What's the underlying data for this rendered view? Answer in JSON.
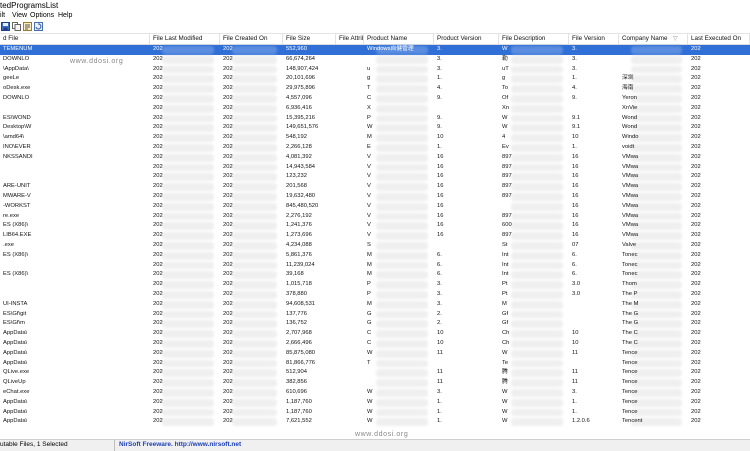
{
  "window": {
    "title": "tedProgramsList"
  },
  "menu": [
    "ilt",
    "View",
    "Options",
    "Help"
  ],
  "toolbar": [
    {
      "icon": "save-icon"
    },
    {
      "icon": "copy-icon"
    },
    {
      "icon": "properties-icon"
    },
    {
      "icon": "refresh-icon"
    }
  ],
  "columns": [
    "d File",
    "File Last Modified",
    "File Created On",
    "File Size",
    "File Attribu...",
    "Product Name",
    "Product Version",
    "File Description",
    "File Version",
    "Company Name",
    "Last Executed On"
  ],
  "rows": [
    {
      "file": "TEMENUM",
      "modified": "202",
      "created": "202",
      "size": "552,960",
      "attr": "",
      "product": "Windows自健管理",
      "pver": "3.",
      "desc": "W",
      "fver": "3.",
      "company": "",
      "last": "202",
      "selected": true
    },
    {
      "file": "DOWNLO",
      "modified": "202",
      "created": "202",
      "size": "66,674,264",
      "attr": "",
      "product": "",
      "pver": "3.",
      "desc": "勒",
      "fver": "3.",
      "company": "",
      "last": "202"
    },
    {
      "file": "\\AppData\\",
      "modified": "202",
      "created": "202",
      "size": "148,907,424",
      "attr": "",
      "product": "u",
      "pver": "3.",
      "desc": "uT",
      "fver": "3.",
      "company": "",
      "last": "202"
    },
    {
      "file": "geeLe",
      "modified": "202",
      "created": "202",
      "size": "20,101,696",
      "attr": "",
      "product": "g",
      "pver": "1.",
      "desc": "g",
      "fver": "1.",
      "company": "深圳",
      "last": "202"
    },
    {
      "file": "oDesk.exe",
      "modified": "202",
      "created": "202",
      "size": "29,975,896",
      "attr": "",
      "product": "T",
      "pver": "4.",
      "desc": "To",
      "fver": "4.",
      "company": "海南",
      "last": "202"
    },
    {
      "file": "DOWNLO",
      "modified": "202",
      "created": "202",
      "size": "4,557,096",
      "attr": "",
      "product": "C",
      "pver": "9.",
      "desc": "Of",
      "fver": "9.",
      "company": "Yeron",
      "last": "202"
    },
    {
      "file": "",
      "modified": "202",
      "created": "202",
      "size": "6,936,416",
      "attr": "",
      "product": "X",
      "pver": "",
      "desc": "Xn",
      "fver": "",
      "company": "XnVie",
      "last": "202"
    },
    {
      "file": "ES\\WOND",
      "modified": "202",
      "created": "202",
      "size": "15,395,216",
      "attr": "",
      "product": "P",
      "pver": "9.",
      "desc": "W",
      "fver": "9.1",
      "company": "Wond",
      "last": "202"
    },
    {
      "file": "Desktop\\W",
      "modified": "202",
      "created": "202",
      "size": "149,651,576",
      "attr": "",
      "product": "W",
      "pver": "9.",
      "desc": "W",
      "fver": "9.1",
      "company": "Wond",
      "last": "202"
    },
    {
      "file": "\\amd64\\",
      "modified": "202",
      "created": "202",
      "size": "548,192",
      "attr": "",
      "product": "M",
      "pver": "10",
      "desc": "4",
      "fver": "10",
      "company": "Windo",
      "last": "202"
    },
    {
      "file": "INO\\EVER",
      "modified": "202",
      "created": "202",
      "size": "2,266,128",
      "attr": "",
      "product": "E",
      "pver": "1.",
      "desc": "Ev",
      "fver": "1.",
      "company": "voidt",
      "last": "202"
    },
    {
      "file": "NKSSANDI",
      "modified": "202",
      "created": "202",
      "size": "4,081,392",
      "attr": "",
      "product": "V",
      "pver": "16",
      "desc": "897",
      "fver": "16",
      "company": "VMwa",
      "last": "202"
    },
    {
      "file": "",
      "modified": "202",
      "created": "202",
      "size": "14,943,584",
      "attr": "",
      "product": "V",
      "pver": "16",
      "desc": "897",
      "fver": "16",
      "company": "VMwa",
      "last": "202"
    },
    {
      "file": "",
      "modified": "202",
      "created": "202",
      "size": "123,232",
      "attr": "",
      "product": "V",
      "pver": "16",
      "desc": "897",
      "fver": "16",
      "company": "VMwa",
      "last": "202"
    },
    {
      "file": "ARE-UNIT",
      "modified": "202",
      "created": "202",
      "size": "201,568",
      "attr": "",
      "product": "V",
      "pver": "16",
      "desc": "897",
      "fver": "16",
      "company": "VMwa",
      "last": "202"
    },
    {
      "file": "MWARE-V",
      "modified": "202",
      "created": "202",
      "size": "19,632,480",
      "attr": "",
      "product": "V",
      "pver": "16",
      "desc": "897",
      "fver": "16",
      "company": "VMwa",
      "last": "202"
    },
    {
      "file": "-WORKST",
      "modified": "202",
      "created": "202",
      "size": "845,480,520",
      "attr": "",
      "product": "V",
      "pver": "16",
      "desc": "",
      "fver": "16",
      "company": "VMwa",
      "last": "202"
    },
    {
      "file": "re.exe",
      "modified": "202",
      "created": "202",
      "size": "2,276,192",
      "attr": "",
      "product": "V",
      "pver": "16",
      "desc": "897",
      "fver": "16",
      "company": "VMwa",
      "last": "202"
    },
    {
      "file": "ES (X86)\\",
      "modified": "202",
      "created": "202",
      "size": "1,241,376",
      "attr": "",
      "product": "V",
      "pver": "16",
      "desc": "600",
      "fver": "16",
      "company": "VMwa",
      "last": "202"
    },
    {
      "file": "LIB64.EXE",
      "modified": "202",
      "created": "202",
      "size": "1,273,696",
      "attr": "",
      "product": "V",
      "pver": "16",
      "desc": "897",
      "fver": "16",
      "company": "VMwa",
      "last": "202"
    },
    {
      "file": ".exe",
      "modified": "202",
      "created": "202",
      "size": "4,234,088",
      "attr": "",
      "product": "S",
      "pver": "",
      "desc": "St",
      "fver": "07",
      "company": "Valve",
      "last": "202"
    },
    {
      "file": "ES (X86)\\",
      "modified": "202",
      "created": "202",
      "size": "5,861,376",
      "attr": "",
      "product": "M",
      "pver": "6.",
      "desc": "Int",
      "fver": "6.",
      "company": "Tonec",
      "last": "202"
    },
    {
      "file": "",
      "modified": "202",
      "created": "202",
      "size": "11,239,024",
      "attr": "",
      "product": "M",
      "pver": "6.",
      "desc": "Int",
      "fver": "6.",
      "company": "Tonec",
      "last": "202"
    },
    {
      "file": "ES (X86)\\",
      "modified": "202",
      "created": "202",
      "size": "39,168",
      "attr": "",
      "product": "M",
      "pver": "6.",
      "desc": "Int",
      "fver": "6.",
      "company": "Tonec",
      "last": "202"
    },
    {
      "file": "",
      "modified": "202",
      "created": "202",
      "size": "1,015,718",
      "attr": "",
      "product": "P",
      "pver": "3.",
      "desc": "Pt",
      "fver": "3.0",
      "company": "Thom",
      "last": "202"
    },
    {
      "file": "",
      "modified": "202",
      "created": "202",
      "size": "378,880",
      "attr": "",
      "product": "P",
      "pver": "3.",
      "desc": "Pt",
      "fver": "3.0",
      "company": "The P",
      "last": "202"
    },
    {
      "file": "UI-INSTA",
      "modified": "202",
      "created": "202",
      "size": "94,608,531",
      "attr": "",
      "product": "M",
      "pver": "3.",
      "desc": "M",
      "fver": "",
      "company": "The M",
      "last": "202"
    },
    {
      "file": "ES\\Gf\\git",
      "modified": "202",
      "created": "202",
      "size": "137,776",
      "attr": "",
      "product": "G",
      "pver": "2.",
      "desc": "Gf",
      "fver": "",
      "company": "The G",
      "last": "202"
    },
    {
      "file": "ES\\Gf\\m",
      "modified": "202",
      "created": "202",
      "size": "136,752",
      "attr": "",
      "product": "G",
      "pver": "2.",
      "desc": "Gf",
      "fver": "",
      "company": "The G",
      "last": "202"
    },
    {
      "file": "AppData\\",
      "modified": "202",
      "created": "202",
      "size": "2,707,968",
      "attr": "",
      "product": "C",
      "pver": "10",
      "desc": "Ch",
      "fver": "10",
      "company": "The C",
      "last": "202"
    },
    {
      "file": "AppData\\",
      "modified": "202",
      "created": "202",
      "size": "2,666,496",
      "attr": "",
      "product": "C",
      "pver": "10",
      "desc": "Ch",
      "fver": "10",
      "company": "The C",
      "last": "202"
    },
    {
      "file": "AppData\\",
      "modified": "202",
      "created": "202",
      "size": "85,875,080",
      "attr": "",
      "product": "W",
      "pver": "11",
      "desc": "W",
      "fver": "11",
      "company": "Tence",
      "last": "202"
    },
    {
      "file": "AppData\\",
      "modified": "202",
      "created": "202",
      "size": "81,866,776",
      "attr": "",
      "product": "T",
      "pver": "",
      "desc": "Te",
      "fver": "",
      "company": "Tence",
      "last": "202"
    },
    {
      "file": "QLive.exe",
      "modified": "202",
      "created": "202",
      "size": "512,904",
      "attr": "",
      "product": "",
      "pver": "11",
      "desc": "腾",
      "fver": "11",
      "company": "Tence",
      "last": "202"
    },
    {
      "file": "QLiveUp",
      "modified": "202",
      "created": "202",
      "size": "382,856",
      "attr": "",
      "product": "",
      "pver": "11",
      "desc": "腾",
      "fver": "11",
      "company": "Tence",
      "last": "202"
    },
    {
      "file": "eChat.exe",
      "modified": "202",
      "created": "202",
      "size": "610,696",
      "attr": "",
      "product": "W",
      "pver": "3.",
      "desc": "W",
      "fver": "3.",
      "company": "Tence",
      "last": "202"
    },
    {
      "file": "AppData\\",
      "modified": "202",
      "created": "202",
      "size": "1,187,760",
      "attr": "",
      "product": "W",
      "pver": "1.",
      "desc": "W",
      "fver": "1.",
      "company": "Tence",
      "last": "202"
    },
    {
      "file": "AppData\\",
      "modified": "202",
      "created": "202",
      "size": "1,187,760",
      "attr": "",
      "product": "W",
      "pver": "1.",
      "desc": "W",
      "fver": "1.",
      "company": "Tence",
      "last": "202"
    },
    {
      "file": "AppData\\",
      "modified": "202",
      "created": "202",
      "size": "7,621,552",
      "attr": "",
      "product": "W",
      "pver": "1.",
      "desc": "W",
      "fver": "1.2.0.6",
      "company": "Tencent",
      "last": "202"
    }
  ],
  "watermark": [
    "www.ddosi.org",
    "www.ddosi.org"
  ],
  "status": {
    "count": "utable Files, 1 Selected",
    "credit": "NirSoft Freeware.  http://www.nirsoft.net"
  }
}
